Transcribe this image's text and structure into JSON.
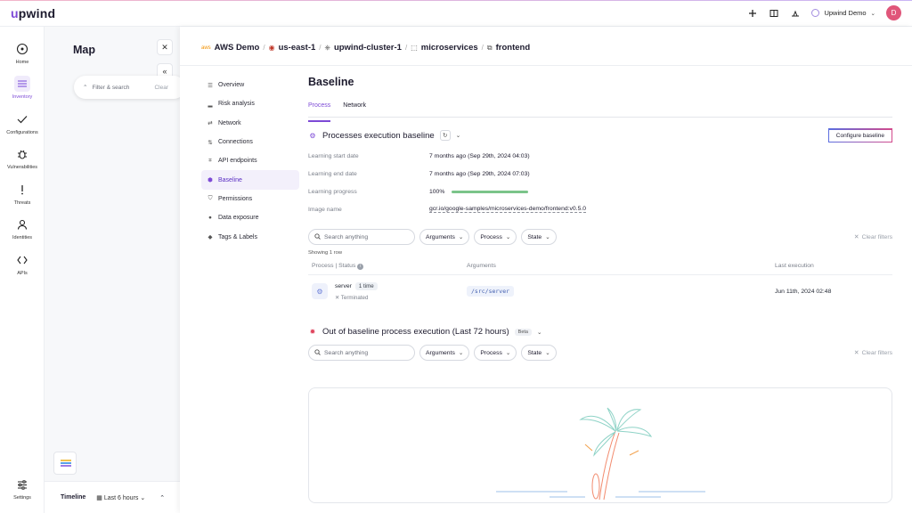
{
  "app": {
    "logo": "upwind",
    "logo_accent_char": "u"
  },
  "topbar": {
    "account_name": "Upwind Demo",
    "avatar_initial": "D"
  },
  "leftnav": [
    {
      "label": "Home",
      "icon": "home-icon"
    },
    {
      "label": "Inventory",
      "icon": "inventory-icon",
      "active": true
    },
    {
      "label": "Configurations",
      "icon": "check-icon"
    },
    {
      "label": "Vulnerabilities",
      "icon": "bug-icon"
    },
    {
      "label": "Threats",
      "icon": "alert-icon"
    },
    {
      "label": "Identities",
      "icon": "user-icon"
    },
    {
      "label": "APIs",
      "icon": "code-icon"
    },
    {
      "label": "Settings",
      "icon": "sliders-icon"
    }
  ],
  "map": {
    "title": "Map",
    "filter_placeholder": "Filter & search",
    "clear_label": "Clear",
    "timeline_label": "Timeline",
    "timeline_range": "Last 6 hours"
  },
  "breadcrumb": [
    {
      "label": "AWS Demo",
      "icon": "aws-icon"
    },
    {
      "label": "us-east-1",
      "icon": "flag-icon"
    },
    {
      "label": "upwind-cluster-1",
      "icon": "kubernetes-icon"
    },
    {
      "label": "microservices",
      "icon": "namespace-icon"
    },
    {
      "label": "frontend",
      "icon": "deployment-icon"
    }
  ],
  "subnav": [
    {
      "label": "Overview",
      "icon": "list-icon"
    },
    {
      "label": "Risk analysis",
      "icon": "bars-icon"
    },
    {
      "label": "Network",
      "icon": "arrows-icon"
    },
    {
      "label": "Connections",
      "icon": "connections-icon"
    },
    {
      "label": "API endpoints",
      "icon": "api-icon"
    },
    {
      "label": "Baseline",
      "icon": "baseline-icon",
      "active": true
    },
    {
      "label": "Permissions",
      "icon": "shield-icon"
    },
    {
      "label": "Data exposure",
      "icon": "database-icon"
    },
    {
      "label": "Tags & Labels",
      "icon": "tag-icon"
    }
  ],
  "page": {
    "title": "Baseline",
    "tabs": [
      {
        "label": "Process",
        "active": true
      },
      {
        "label": "Network"
      }
    ]
  },
  "baseline": {
    "title": "Processes execution baseline",
    "configure_label": "Configure baseline",
    "rows": [
      {
        "key": "Learning start date",
        "value": "7 months ago (Sep 29th, 2024 04:03)"
      },
      {
        "key": "Learning end date",
        "value": "7 months ago (Sep 29th, 2024 07:03)"
      },
      {
        "key": "Learning progress",
        "value": "100%"
      },
      {
        "key": "Image name",
        "value": "gcr.io/google-samples/microservices-demo/frontend:v0.5.0"
      }
    ],
    "progress": 1.0,
    "progress_color": "#7bc48a"
  },
  "filters": {
    "search_placeholder": "Search anything",
    "chips": [
      "Arguments",
      "Process",
      "State"
    ],
    "clear_label": "Clear filters"
  },
  "table": {
    "showing": "Showing 1 row",
    "columns": [
      "Process | Status",
      "Arguments",
      "Last execution"
    ],
    "rows": [
      {
        "process": "server",
        "count": "1 time",
        "status": "Terminated",
        "arguments": "/src/server",
        "last_execution": "Jun 11th, 2024 02:48"
      }
    ]
  },
  "out_of_baseline": {
    "title": "Out of baseline process execution (Last 72 hours)",
    "badge": "Beta"
  },
  "colors": {
    "accent": "#7d4ad6",
    "danger": "#e0455e"
  }
}
